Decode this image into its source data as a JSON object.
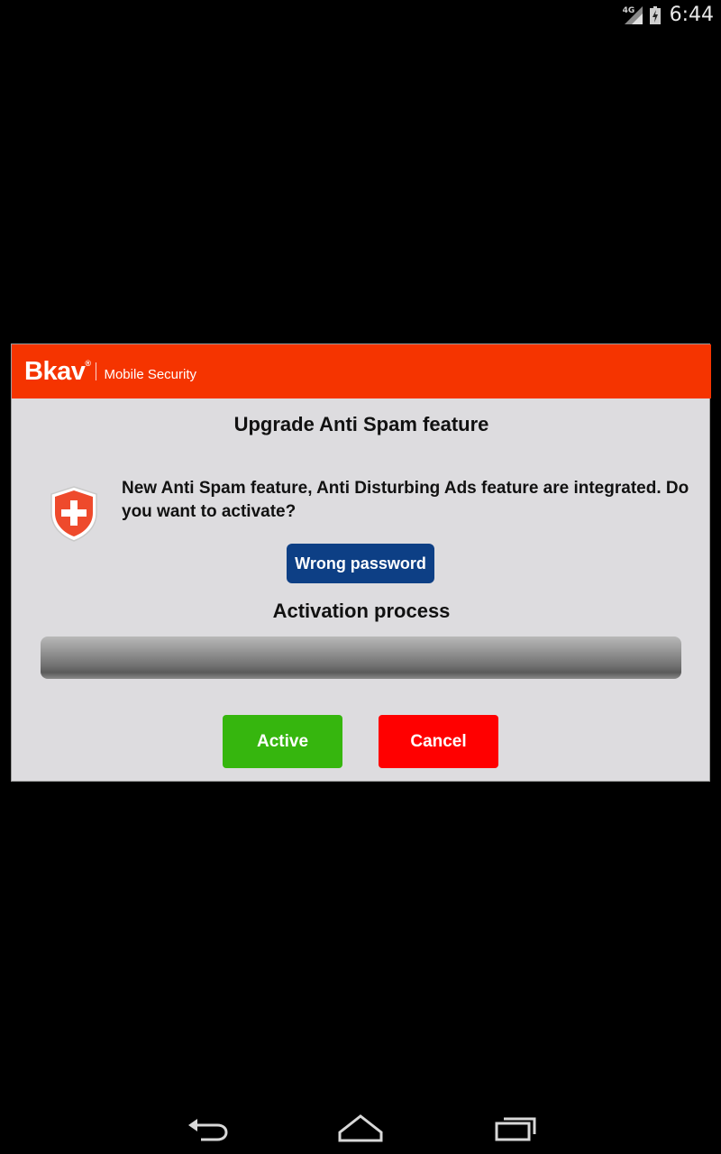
{
  "status_bar": {
    "network": "4G",
    "time": "6:44",
    "icons": [
      "signal-icon",
      "battery-icon"
    ]
  },
  "dialog": {
    "brand": "Bkav",
    "brand_mark": "®",
    "product": "Mobile Security",
    "title": "Upgrade Anti Spam feature",
    "icon": "shield-plus-icon",
    "message": "New Anti Spam feature, Anti Disturbing Ads feature are integrated. Do you want to activate?",
    "wrong_password_label": "Wrong password",
    "process_title": "Activation process",
    "progress": 0,
    "active_label": "Active",
    "cancel_label": "Cancel",
    "colors": {
      "header": "#f53400",
      "wrong_password_button": "#0d3f85",
      "active_button": "#36b60e",
      "cancel_button": "#ff0000"
    }
  },
  "nav_bar": {
    "icons": [
      "back-icon",
      "home-icon",
      "recents-icon"
    ]
  }
}
